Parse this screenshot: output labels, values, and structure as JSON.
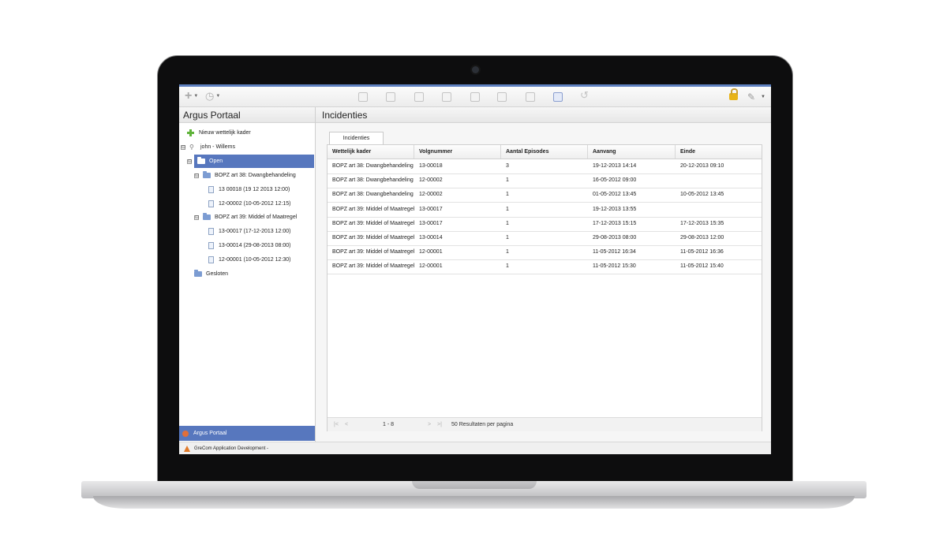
{
  "toolbar": {
    "left_icons": [
      "add-icon",
      "clock-icon"
    ],
    "middle_icons": [
      "home-icon",
      "document-icon",
      "checklist-icon",
      "copy-icon",
      "edit-document-icon",
      "grid-icon",
      "pencil-icon",
      "database-icon",
      "refresh-icon"
    ],
    "right_icons": [
      "lock-icon",
      "wrench-icon"
    ]
  },
  "left_panel": {
    "title": "Argus Portaal",
    "tree": [
      {
        "label": "Nieuw wettelijk kader",
        "icon": "add-icon",
        "level": 0
      },
      {
        "label": "john - Willems",
        "icon": "search-icon",
        "level": 0,
        "expander": "⊟"
      },
      {
        "label": "Open",
        "icon": "folder-icon",
        "level": 1,
        "expander": "⊟",
        "selected": true
      },
      {
        "label": "BOPZ art 38: Dwangbehandeling",
        "icon": "folder-icon",
        "level": 2,
        "expander": "⊟"
      },
      {
        "label": "13 00018 (19 12 2013 12:00)",
        "icon": "document-icon",
        "level": 3
      },
      {
        "label": "12-00002 (10-05-2012 12:15)",
        "icon": "document-icon",
        "level": 3
      },
      {
        "label": "BOPZ art 39: Middel of Maatregel",
        "icon": "folder-icon",
        "level": 2,
        "expander": "⊟"
      },
      {
        "label": "13-00017 (17-12-2013 12:00)",
        "icon": "document-icon",
        "level": 3
      },
      {
        "label": "13-00014 (29-08-2013 08:00)",
        "icon": "document-icon",
        "level": 3
      },
      {
        "label": "12-00001 (10-05-2012 12:30)",
        "icon": "document-icon",
        "level": 3
      },
      {
        "label": "Gesloten",
        "icon": "folder-icon",
        "level": 1
      }
    ],
    "footer": "Argus Portaal"
  },
  "status_bar": {
    "text": "GreCom Application Development -"
  },
  "main": {
    "title": "Incidenties",
    "tab": "Incidenties",
    "columns": [
      "Wettelijk kader",
      "Volgnummer",
      "Aantal Episodes",
      "Aanvang",
      "Einde"
    ],
    "rows": [
      [
        "BOPZ art 38: Dwangbehandeling",
        "13-00018",
        "3",
        "19-12-2013 14:14",
        "20-12-2013 09:10"
      ],
      [
        "BOPZ art 38: Dwangbehandeling",
        "12-00002",
        "1",
        "16-05-2012 09:00",
        ""
      ],
      [
        "BOPZ art 38: Dwangbehandeling",
        "12-00002",
        "1",
        "01-05-2012 13:45",
        "10-05-2012 13:45"
      ],
      [
        "BOPZ art 39: Middel of Maatregel",
        "13-00017",
        "1",
        "19-12-2013 13:55",
        ""
      ],
      [
        "BOPZ art 39: Middel of Maatregel",
        "13-00017",
        "1",
        "17-12-2013 15:15",
        "17-12-2013 15:35"
      ],
      [
        "BOPZ art 39: Middel of Maatregel",
        "13-00014",
        "1",
        "29-08-2013 08:00",
        "29-08-2013 12:00"
      ],
      [
        "BOPZ art 39: Middel of Maatregel",
        "12-00001",
        "1",
        "11-05-2012 16:34",
        "11-05-2012 16:36"
      ],
      [
        "BOPZ art 39: Middel of Maatregel",
        "12-00001",
        "1",
        "11-05-2012 15:30",
        "11-05-2012 15:40"
      ]
    ],
    "pager": {
      "range": "1 - 8",
      "page_size": "50 Resultaten per pagina"
    }
  },
  "colors": {
    "accent": "#5777be",
    "topline": "#5d7fbf"
  }
}
